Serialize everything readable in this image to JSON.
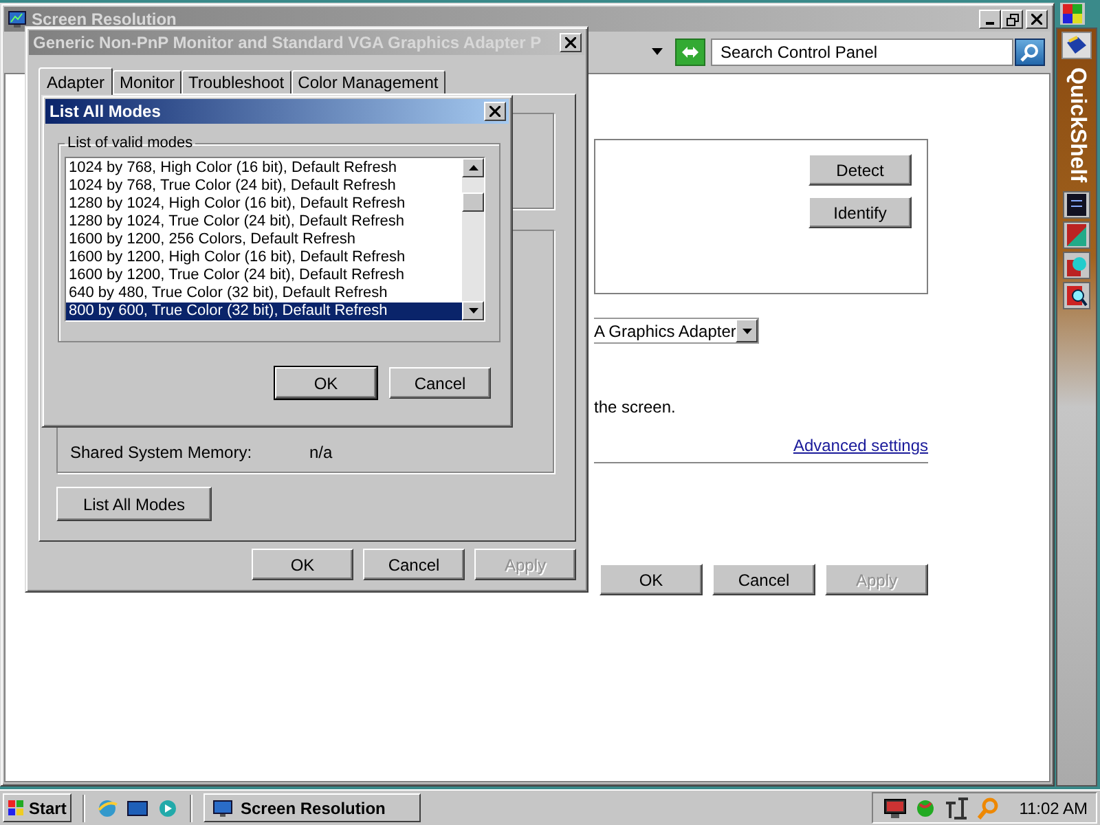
{
  "main_window": {
    "title": "Screen Resolution",
    "active": false,
    "search": {
      "placeholder": "Search Control Panel"
    },
    "side_buttons": [
      "Detect",
      "Identify"
    ],
    "display_dropdown": {
      "value": "A Graphics Adapter"
    },
    "note": "the screen.",
    "link": "Advanced settings",
    "buttons": [
      {
        "label": "OK",
        "disabled": false
      },
      {
        "label": "Cancel",
        "disabled": false
      },
      {
        "label": "Apply",
        "disabled": true
      }
    ]
  },
  "properties_dialog": {
    "title": "Generic Non-PnP Monitor and Standard VGA Graphics Adapter P",
    "active": false,
    "tabs": [
      {
        "label": "Adapter",
        "selected": true
      },
      {
        "label": "Monitor",
        "selected": false
      },
      {
        "label": "Troubleshoot",
        "selected": false
      },
      {
        "label": "Color Management",
        "selected": false
      }
    ],
    "memory_rows": [
      {
        "label": "Shared System Memory:",
        "value": "n/a"
      }
    ],
    "list_modes_button": "List All Modes",
    "buttons": [
      {
        "label": "OK",
        "disabled": false
      },
      {
        "label": "Cancel",
        "disabled": false
      },
      {
        "label": "Apply",
        "disabled": true
      }
    ]
  },
  "modes_dialog": {
    "title": "List All Modes",
    "active": true,
    "group": "List of valid modes",
    "modes": [
      {
        "label": "1024 by 768, High Color (16 bit), Default Refresh",
        "selected": false
      },
      {
        "label": "1024 by 768, True Color (24 bit), Default Refresh",
        "selected": false
      },
      {
        "label": "1280 by 1024, High Color (16 bit), Default Refresh",
        "selected": false
      },
      {
        "label": "1280 by 1024, True Color (24 bit), Default Refresh",
        "selected": false
      },
      {
        "label": "1600 by 1200, 256 Colors, Default Refresh",
        "selected": false
      },
      {
        "label": "1600 by 1200, High Color (16 bit), Default Refresh",
        "selected": false
      },
      {
        "label": "1600 by 1200, True Color (24 bit), Default Refresh",
        "selected": false
      },
      {
        "label": "640 by 480, True Color (32 bit), Default Refresh",
        "selected": false
      },
      {
        "label": "800 by 600, True Color (32 bit), Default Refresh",
        "selected": true
      }
    ],
    "buttons": [
      "OK",
      "Cancel"
    ]
  },
  "quickshelf": {
    "title": "QuickShelf"
  },
  "taskbar": {
    "start": "Start",
    "tasks": [
      {
        "label": "Screen Resolution",
        "selected": false
      }
    ],
    "clock": "11:02 AM"
  }
}
